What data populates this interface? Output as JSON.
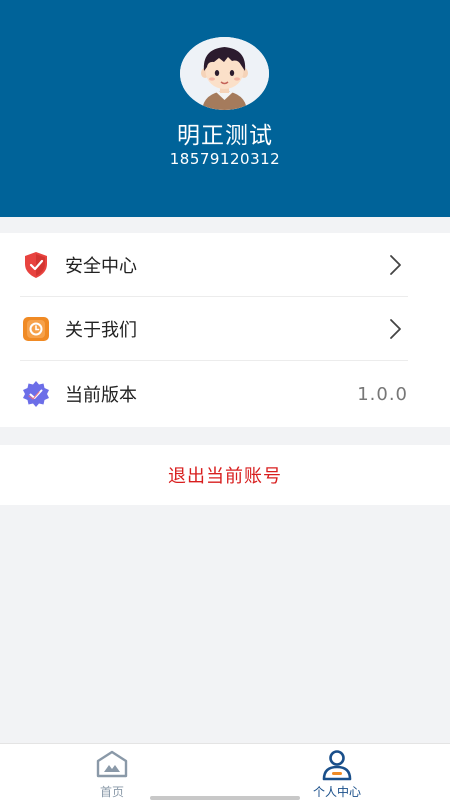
{
  "profile": {
    "name": "明正测试",
    "phone": "18579120312"
  },
  "menu": {
    "items": [
      {
        "label": "安全中心",
        "icon": "shield-check-icon",
        "icon_color": "#e8433f"
      },
      {
        "label": "关于我们",
        "icon": "info-badge-icon",
        "icon_color": "#f08a24"
      },
      {
        "label": "当前版本",
        "icon": "version-badge-icon",
        "icon_color": "#6c6ee8",
        "value": "1.0.0"
      }
    ]
  },
  "logout": {
    "label": "退出当前账号",
    "color": "#d81e1e"
  },
  "tabbar": {
    "tabs": [
      {
        "label": "首页",
        "icon": "home-icon",
        "active": false
      },
      {
        "label": "个人中心",
        "icon": "person-icon",
        "active": true
      }
    ]
  },
  "colors": {
    "header_bg": "#006399",
    "page_bg": "#f2f3f5",
    "active_tab": "#1a4f8a",
    "inactive_tab": "#8a99a8"
  }
}
